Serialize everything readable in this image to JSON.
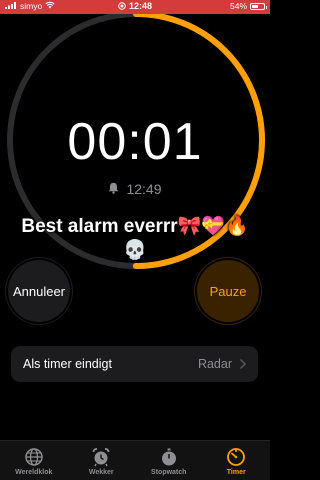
{
  "status_bar": {
    "carrier": "simyo",
    "time": "12:48",
    "battery_text": "54%",
    "battery_level": 0.54,
    "background_color": "#d43b3b"
  },
  "timer": {
    "remaining": "00:01",
    "end_time": "12:49",
    "progress_remaining": 0.5,
    "ring_color": "#ff9f0a",
    "track_color": "#2c2c2e"
  },
  "caption": {
    "line1": "Best alarm everrr🎀💝🔥",
    "line2": "💀"
  },
  "buttons": {
    "cancel_label": "Annuleer",
    "pause_label": "Pauze"
  },
  "when_timer_ends": {
    "label": "Als timer eindigt",
    "value": "Radar"
  },
  "tabs": [
    {
      "label": "Wereldklok",
      "icon": "globe-icon"
    },
    {
      "label": "Wekker",
      "icon": "alarm-clock-icon"
    },
    {
      "label": "Stopwatch",
      "icon": "stopwatch-icon"
    },
    {
      "label": "Timer",
      "icon": "timer-icon",
      "active": true
    }
  ],
  "accent_color": "#ff9f0a"
}
